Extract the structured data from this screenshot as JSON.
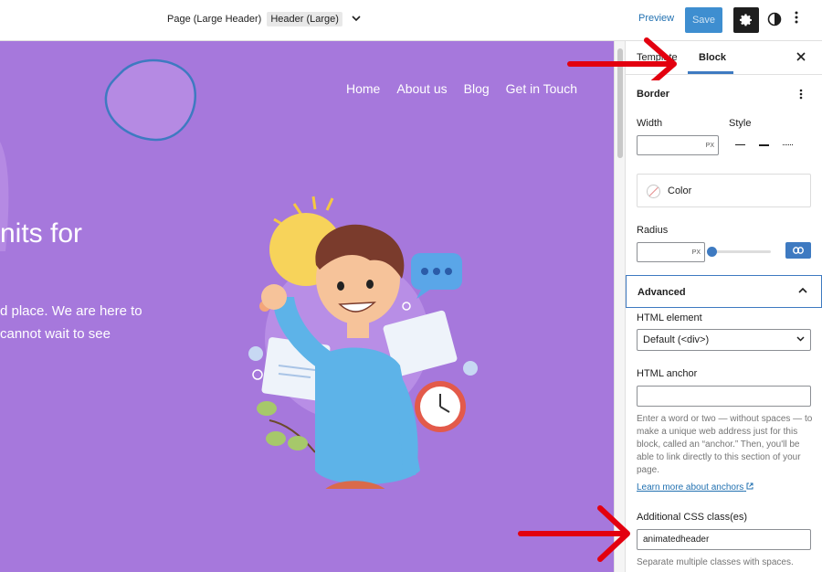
{
  "topbar": {
    "template_name": "Page (Large Header)",
    "template_part": "Header (Large)",
    "preview_label": "Preview",
    "save_label": "Save"
  },
  "canvas": {
    "nav": [
      "Home",
      "About us",
      "Blog",
      "Get in Touch"
    ],
    "hero_line1": "nits for",
    "hero_line2": "d place. We are here to",
    "hero_line3": "cannot wait to see"
  },
  "sidebar": {
    "tabs": {
      "template": "Template",
      "block": "Block"
    },
    "border": {
      "heading": "Border",
      "width_label": "Width",
      "style_label": "Style",
      "width_unit": "PX",
      "color_label": "Color",
      "radius_label": "Radius",
      "radius_unit": "PX"
    },
    "advanced": {
      "heading": "Advanced",
      "html_element_label": "HTML element",
      "html_element_value": "Default (<div>)",
      "html_anchor_label": "HTML anchor",
      "html_anchor_value": "",
      "anchor_help": "Enter a word or two — without spaces — to make a unique web address just for this block, called an “anchor.” Then, you'll be able to link directly to this section of your page.",
      "learn_more": "Learn more about anchors",
      "css_label": "Additional CSS class(es)",
      "css_value": "animatedheader",
      "css_help": "Separate multiple classes with spaces."
    }
  },
  "colors": {
    "canvas_bg": "#a678dc",
    "accent": "#3e7ac1",
    "annotation_arrow": "#e3000f"
  }
}
